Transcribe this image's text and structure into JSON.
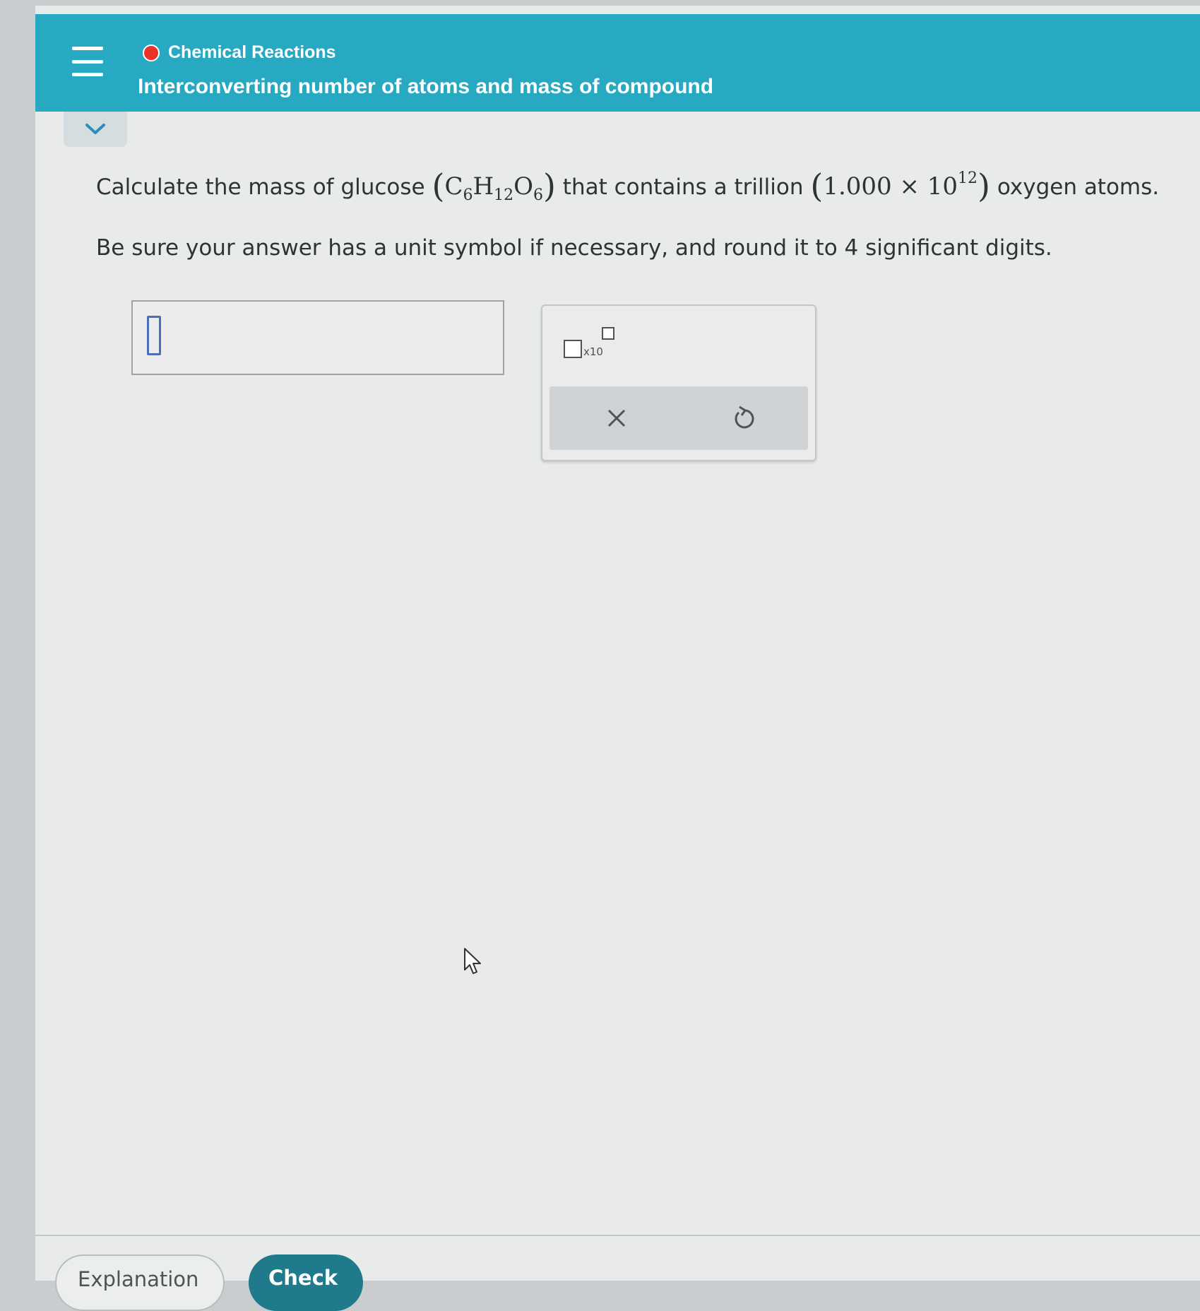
{
  "header": {
    "menu_icon": "hamburger-menu-icon",
    "topic_status_color": "#e8322a",
    "topic": "Chemical Reactions",
    "title": "Interconverting number of atoms and mass of compound",
    "bg_color": "#28a9c2"
  },
  "collapse_icon": "chevron-down-icon",
  "question": {
    "text_before": "Calculate the mass of glucose",
    "formula": {
      "open": "(",
      "c": "C",
      "c_sub": "6",
      "h": "H",
      "h_sub": "12",
      "o": "O",
      "o_sub": "6",
      "close": ")"
    },
    "text_middle": "that contains a trillion",
    "quantity": {
      "open": "(",
      "mantissa": "1.000",
      "times": "×",
      "base": "10",
      "exponent": "12",
      "close": ")"
    },
    "text_after": "oxygen atoms."
  },
  "instructions": "Be sure your answer has a unit symbol if necessary, and round it to 4 significant digits.",
  "answer": {
    "value": ""
  },
  "toolbar": {
    "sci_notation_label": "x10",
    "sci_notation_icon": "scientific-notation-icon",
    "clear_icon": "close-icon",
    "undo_icon": "undo-icon"
  },
  "footer": {
    "explanation_label": "Explanation",
    "check_label": "Check",
    "check_color": "#1f7a8c"
  }
}
